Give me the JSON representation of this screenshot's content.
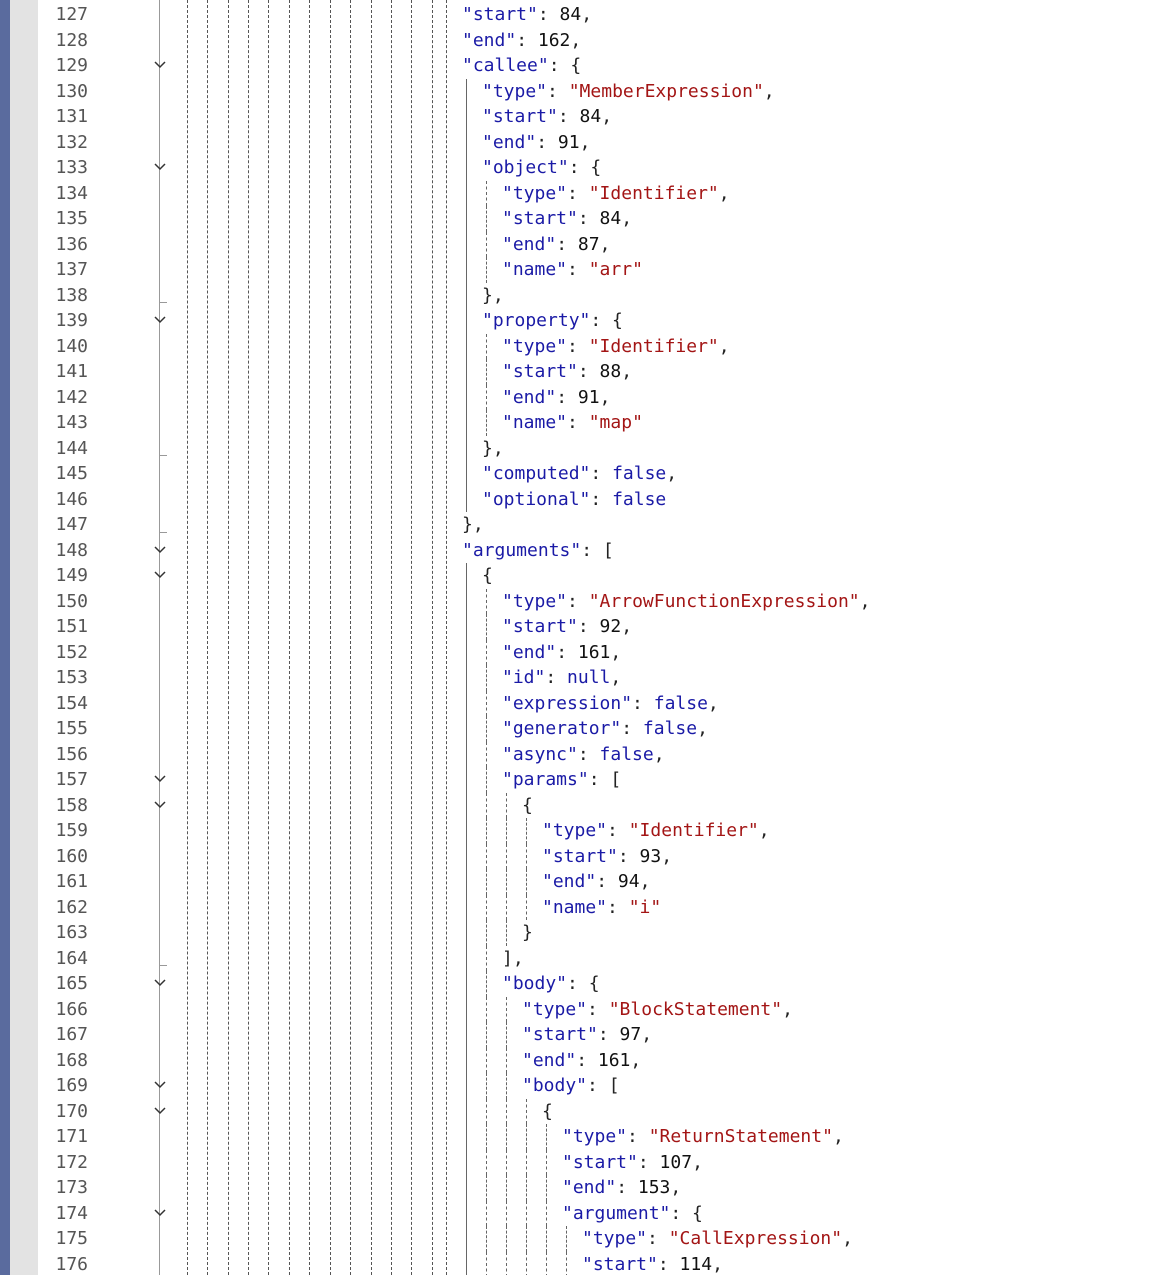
{
  "editor": {
    "colors": {
      "key": "#1a1aa6",
      "string": "#a31515",
      "number": "#111111",
      "keyword": "#1a1aa6",
      "punct": "#222222",
      "line_number": "#555555",
      "side_bar": "#5a6b9e"
    },
    "lines": [
      {
        "no": "127",
        "fold": "",
        "indent": 0,
        "tokens": [
          {
            "t": "k",
            "v": "\"start\""
          },
          {
            "t": "p",
            "v": ": "
          },
          {
            "t": "n",
            "v": "84"
          },
          {
            "t": "p",
            "v": ","
          }
        ]
      },
      {
        "no": "128",
        "fold": "",
        "indent": 0,
        "tokens": [
          {
            "t": "k",
            "v": "\"end\""
          },
          {
            "t": "p",
            "v": ": "
          },
          {
            "t": "n",
            "v": "162"
          },
          {
            "t": "p",
            "v": ","
          }
        ]
      },
      {
        "no": "129",
        "fold": "v",
        "indent": 0,
        "tokens": [
          {
            "t": "k",
            "v": "\"callee\""
          },
          {
            "t": "p",
            "v": ": {"
          }
        ]
      },
      {
        "no": "130",
        "fold": "",
        "indent": 1,
        "tokens": [
          {
            "t": "k",
            "v": "\"type\""
          },
          {
            "t": "p",
            "v": ": "
          },
          {
            "t": "s",
            "v": "\"MemberExpression\""
          },
          {
            "t": "p",
            "v": ","
          }
        ]
      },
      {
        "no": "131",
        "fold": "",
        "indent": 1,
        "tokens": [
          {
            "t": "k",
            "v": "\"start\""
          },
          {
            "t": "p",
            "v": ": "
          },
          {
            "t": "n",
            "v": "84"
          },
          {
            "t": "p",
            "v": ","
          }
        ]
      },
      {
        "no": "132",
        "fold": "",
        "indent": 1,
        "tokens": [
          {
            "t": "k",
            "v": "\"end\""
          },
          {
            "t": "p",
            "v": ": "
          },
          {
            "t": "n",
            "v": "91"
          },
          {
            "t": "p",
            "v": ","
          }
        ]
      },
      {
        "no": "133",
        "fold": "v",
        "indent": 1,
        "tokens": [
          {
            "t": "k",
            "v": "\"object\""
          },
          {
            "t": "p",
            "v": ": {"
          }
        ]
      },
      {
        "no": "134",
        "fold": "",
        "indent": 2,
        "tokens": [
          {
            "t": "k",
            "v": "\"type\""
          },
          {
            "t": "p",
            "v": ": "
          },
          {
            "t": "s",
            "v": "\"Identifier\""
          },
          {
            "t": "p",
            "v": ","
          }
        ]
      },
      {
        "no": "135",
        "fold": "",
        "indent": 2,
        "tokens": [
          {
            "t": "k",
            "v": "\"start\""
          },
          {
            "t": "p",
            "v": ": "
          },
          {
            "t": "n",
            "v": "84"
          },
          {
            "t": "p",
            "v": ","
          }
        ]
      },
      {
        "no": "136",
        "fold": "",
        "indent": 2,
        "tokens": [
          {
            "t": "k",
            "v": "\"end\""
          },
          {
            "t": "p",
            "v": ": "
          },
          {
            "t": "n",
            "v": "87"
          },
          {
            "t": "p",
            "v": ","
          }
        ]
      },
      {
        "no": "137",
        "fold": "",
        "indent": 2,
        "tokens": [
          {
            "t": "k",
            "v": "\"name\""
          },
          {
            "t": "p",
            "v": ": "
          },
          {
            "t": "s",
            "v": "\"arr\""
          }
        ]
      },
      {
        "no": "138",
        "fold": "end",
        "indent": 1,
        "tokens": [
          {
            "t": "p",
            "v": "},"
          }
        ]
      },
      {
        "no": "139",
        "fold": "v",
        "indent": 1,
        "tokens": [
          {
            "t": "k",
            "v": "\"property\""
          },
          {
            "t": "p",
            "v": ": {"
          }
        ]
      },
      {
        "no": "140",
        "fold": "",
        "indent": 2,
        "tokens": [
          {
            "t": "k",
            "v": "\"type\""
          },
          {
            "t": "p",
            "v": ": "
          },
          {
            "t": "s",
            "v": "\"Identifier\""
          },
          {
            "t": "p",
            "v": ","
          }
        ]
      },
      {
        "no": "141",
        "fold": "",
        "indent": 2,
        "tokens": [
          {
            "t": "k",
            "v": "\"start\""
          },
          {
            "t": "p",
            "v": ": "
          },
          {
            "t": "n",
            "v": "88"
          },
          {
            "t": "p",
            "v": ","
          }
        ]
      },
      {
        "no": "142",
        "fold": "",
        "indent": 2,
        "tokens": [
          {
            "t": "k",
            "v": "\"end\""
          },
          {
            "t": "p",
            "v": ": "
          },
          {
            "t": "n",
            "v": "91"
          },
          {
            "t": "p",
            "v": ","
          }
        ]
      },
      {
        "no": "143",
        "fold": "",
        "indent": 2,
        "tokens": [
          {
            "t": "k",
            "v": "\"name\""
          },
          {
            "t": "p",
            "v": ": "
          },
          {
            "t": "s",
            "v": "\"map\""
          }
        ]
      },
      {
        "no": "144",
        "fold": "end",
        "indent": 1,
        "tokens": [
          {
            "t": "p",
            "v": "},"
          }
        ]
      },
      {
        "no": "145",
        "fold": "",
        "indent": 1,
        "tokens": [
          {
            "t": "k",
            "v": "\"computed\""
          },
          {
            "t": "p",
            "v": ": "
          },
          {
            "t": "kw",
            "v": "false"
          },
          {
            "t": "p",
            "v": ","
          }
        ]
      },
      {
        "no": "146",
        "fold": "",
        "indent": 1,
        "tokens": [
          {
            "t": "k",
            "v": "\"optional\""
          },
          {
            "t": "p",
            "v": ": "
          },
          {
            "t": "kw",
            "v": "false"
          }
        ]
      },
      {
        "no": "147",
        "fold": "end",
        "indent": 0,
        "tokens": [
          {
            "t": "p",
            "v": "},"
          }
        ]
      },
      {
        "no": "148",
        "fold": "v",
        "indent": 0,
        "tokens": [
          {
            "t": "k",
            "v": "\"arguments\""
          },
          {
            "t": "p",
            "v": ": ["
          }
        ]
      },
      {
        "no": "149",
        "fold": "v",
        "indent": 1,
        "tokens": [
          {
            "t": "p",
            "v": "{"
          }
        ]
      },
      {
        "no": "150",
        "fold": "",
        "indent": 2,
        "tokens": [
          {
            "t": "k",
            "v": "\"type\""
          },
          {
            "t": "p",
            "v": ": "
          },
          {
            "t": "s",
            "v": "\"ArrowFunctionExpression\""
          },
          {
            "t": "p",
            "v": ","
          }
        ]
      },
      {
        "no": "151",
        "fold": "",
        "indent": 2,
        "tokens": [
          {
            "t": "k",
            "v": "\"start\""
          },
          {
            "t": "p",
            "v": ": "
          },
          {
            "t": "n",
            "v": "92"
          },
          {
            "t": "p",
            "v": ","
          }
        ]
      },
      {
        "no": "152",
        "fold": "",
        "indent": 2,
        "tokens": [
          {
            "t": "k",
            "v": "\"end\""
          },
          {
            "t": "p",
            "v": ": "
          },
          {
            "t": "n",
            "v": "161"
          },
          {
            "t": "p",
            "v": ","
          }
        ]
      },
      {
        "no": "153",
        "fold": "",
        "indent": 2,
        "tokens": [
          {
            "t": "k",
            "v": "\"id\""
          },
          {
            "t": "p",
            "v": ": "
          },
          {
            "t": "kw",
            "v": "null"
          },
          {
            "t": "p",
            "v": ","
          }
        ]
      },
      {
        "no": "154",
        "fold": "",
        "indent": 2,
        "tokens": [
          {
            "t": "k",
            "v": "\"expression\""
          },
          {
            "t": "p",
            "v": ": "
          },
          {
            "t": "kw",
            "v": "false"
          },
          {
            "t": "p",
            "v": ","
          }
        ]
      },
      {
        "no": "155",
        "fold": "",
        "indent": 2,
        "tokens": [
          {
            "t": "k",
            "v": "\"generator\""
          },
          {
            "t": "p",
            "v": ": "
          },
          {
            "t": "kw",
            "v": "false"
          },
          {
            "t": "p",
            "v": ","
          }
        ]
      },
      {
        "no": "156",
        "fold": "",
        "indent": 2,
        "tokens": [
          {
            "t": "k",
            "v": "\"async\""
          },
          {
            "t": "p",
            "v": ": "
          },
          {
            "t": "kw",
            "v": "false"
          },
          {
            "t": "p",
            "v": ","
          }
        ]
      },
      {
        "no": "157",
        "fold": "v",
        "indent": 2,
        "tokens": [
          {
            "t": "k",
            "v": "\"params\""
          },
          {
            "t": "p",
            "v": ": ["
          }
        ]
      },
      {
        "no": "158",
        "fold": "v",
        "indent": 3,
        "tokens": [
          {
            "t": "p",
            "v": "{"
          }
        ]
      },
      {
        "no": "159",
        "fold": "",
        "indent": 4,
        "tokens": [
          {
            "t": "k",
            "v": "\"type\""
          },
          {
            "t": "p",
            "v": ": "
          },
          {
            "t": "s",
            "v": "\"Identifier\""
          },
          {
            "t": "p",
            "v": ","
          }
        ]
      },
      {
        "no": "160",
        "fold": "",
        "indent": 4,
        "tokens": [
          {
            "t": "k",
            "v": "\"start\""
          },
          {
            "t": "p",
            "v": ": "
          },
          {
            "t": "n",
            "v": "93"
          },
          {
            "t": "p",
            "v": ","
          }
        ]
      },
      {
        "no": "161",
        "fold": "",
        "indent": 4,
        "tokens": [
          {
            "t": "k",
            "v": "\"end\""
          },
          {
            "t": "p",
            "v": ": "
          },
          {
            "t": "n",
            "v": "94"
          },
          {
            "t": "p",
            "v": ","
          }
        ]
      },
      {
        "no": "162",
        "fold": "",
        "indent": 4,
        "tokens": [
          {
            "t": "k",
            "v": "\"name\""
          },
          {
            "t": "p",
            "v": ": "
          },
          {
            "t": "s",
            "v": "\"i\""
          }
        ]
      },
      {
        "no": "163",
        "fold": "",
        "indent": 3,
        "tokens": [
          {
            "t": "p",
            "v": "}"
          }
        ]
      },
      {
        "no": "164",
        "fold": "end",
        "indent": 2,
        "tokens": [
          {
            "t": "p",
            "v": "],"
          }
        ]
      },
      {
        "no": "165",
        "fold": "v",
        "indent": 2,
        "tokens": [
          {
            "t": "k",
            "v": "\"body\""
          },
          {
            "t": "p",
            "v": ": {"
          }
        ]
      },
      {
        "no": "166",
        "fold": "",
        "indent": 3,
        "tokens": [
          {
            "t": "k",
            "v": "\"type\""
          },
          {
            "t": "p",
            "v": ": "
          },
          {
            "t": "s",
            "v": "\"BlockStatement\""
          },
          {
            "t": "p",
            "v": ","
          }
        ]
      },
      {
        "no": "167",
        "fold": "",
        "indent": 3,
        "tokens": [
          {
            "t": "k",
            "v": "\"start\""
          },
          {
            "t": "p",
            "v": ": "
          },
          {
            "t": "n",
            "v": "97"
          },
          {
            "t": "p",
            "v": ","
          }
        ]
      },
      {
        "no": "168",
        "fold": "",
        "indent": 3,
        "tokens": [
          {
            "t": "k",
            "v": "\"end\""
          },
          {
            "t": "p",
            "v": ": "
          },
          {
            "t": "n",
            "v": "161"
          },
          {
            "t": "p",
            "v": ","
          }
        ]
      },
      {
        "no": "169",
        "fold": "v",
        "indent": 3,
        "tokens": [
          {
            "t": "k",
            "v": "\"body\""
          },
          {
            "t": "p",
            "v": ": ["
          }
        ]
      },
      {
        "no": "170",
        "fold": "v",
        "indent": 4,
        "tokens": [
          {
            "t": "p",
            "v": "{"
          }
        ]
      },
      {
        "no": "171",
        "fold": "",
        "indent": 5,
        "tokens": [
          {
            "t": "k",
            "v": "\"type\""
          },
          {
            "t": "p",
            "v": ": "
          },
          {
            "t": "s",
            "v": "\"ReturnStatement\""
          },
          {
            "t": "p",
            "v": ","
          }
        ]
      },
      {
        "no": "172",
        "fold": "",
        "indent": 5,
        "tokens": [
          {
            "t": "k",
            "v": "\"start\""
          },
          {
            "t": "p",
            "v": ": "
          },
          {
            "t": "n",
            "v": "107"
          },
          {
            "t": "p",
            "v": ","
          }
        ]
      },
      {
        "no": "173",
        "fold": "",
        "indent": 5,
        "tokens": [
          {
            "t": "k",
            "v": "\"end\""
          },
          {
            "t": "p",
            "v": ": "
          },
          {
            "t": "n",
            "v": "153"
          },
          {
            "t": "p",
            "v": ","
          }
        ]
      },
      {
        "no": "174",
        "fold": "v",
        "indent": 5,
        "tokens": [
          {
            "t": "k",
            "v": "\"argument\""
          },
          {
            "t": "p",
            "v": ": {"
          }
        ]
      },
      {
        "no": "175",
        "fold": "",
        "indent": 6,
        "tokens": [
          {
            "t": "k",
            "v": "\"type\""
          },
          {
            "t": "p",
            "v": ": "
          },
          {
            "t": "s",
            "v": "\"CallExpression\""
          },
          {
            "t": "p",
            "v": ","
          }
        ]
      },
      {
        "no": "176",
        "fold": "",
        "indent": 6,
        "tokens": [
          {
            "t": "k",
            "v": "\"start\""
          },
          {
            "t": "p",
            "v": ": "
          },
          {
            "t": "n",
            "v": "114"
          },
          {
            "t": "p",
            "v": ","
          }
        ]
      }
    ]
  }
}
